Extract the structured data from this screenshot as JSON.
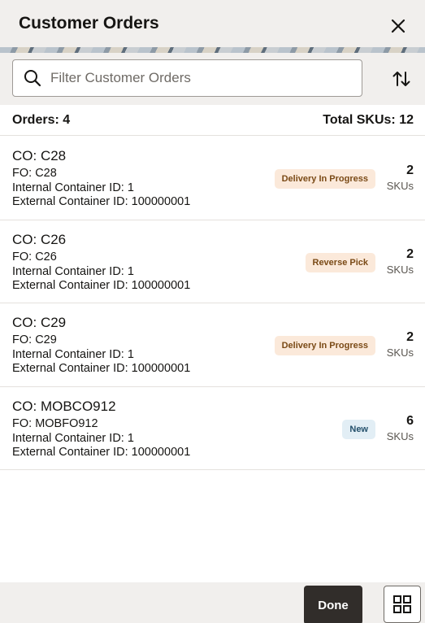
{
  "header": {
    "title": "Customer Orders",
    "close_icon": "close-icon"
  },
  "search": {
    "placeholder": "Filter Customer Orders",
    "value": ""
  },
  "summary": {
    "orders_label": "Orders: 4",
    "total_skus_label": "Total SKUs: 12"
  },
  "orders": [
    {
      "co": "CO: C28",
      "fo": "FO: C28",
      "internal": "Internal Container ID: 1",
      "external": "External Container ID: 100000001",
      "status": "Delivery In Progress",
      "status_kind": "progress",
      "skus": "2",
      "skus_unit": "SKUs"
    },
    {
      "co": "CO: C26",
      "fo": "FO: C26",
      "internal": "Internal Container ID: 1",
      "external": "External Container ID: 100000001",
      "status": "Reverse Pick",
      "status_kind": "progress",
      "skus": "2",
      "skus_unit": "SKUs"
    },
    {
      "co": "CO: C29",
      "fo": "FO: C29",
      "internal": "Internal Container ID: 1",
      "external": "External Container ID: 100000001",
      "status": "Delivery In Progress",
      "status_kind": "progress",
      "skus": "2",
      "skus_unit": "SKUs"
    },
    {
      "co": "CO: MOBCO912",
      "fo": "FO: MOBFO912",
      "internal": "Internal Container ID: 1",
      "external": "External Container ID: 100000001",
      "status": "New",
      "status_kind": "new",
      "skus": "6",
      "skus_unit": "SKUs"
    }
  ],
  "footer": {
    "done_label": "Done"
  },
  "colors": {
    "header_bg": "#f1efed",
    "done_bg": "#312d2a",
    "badge_progress_bg": "#fbe9da",
    "badge_new_bg": "#e2eef5"
  }
}
